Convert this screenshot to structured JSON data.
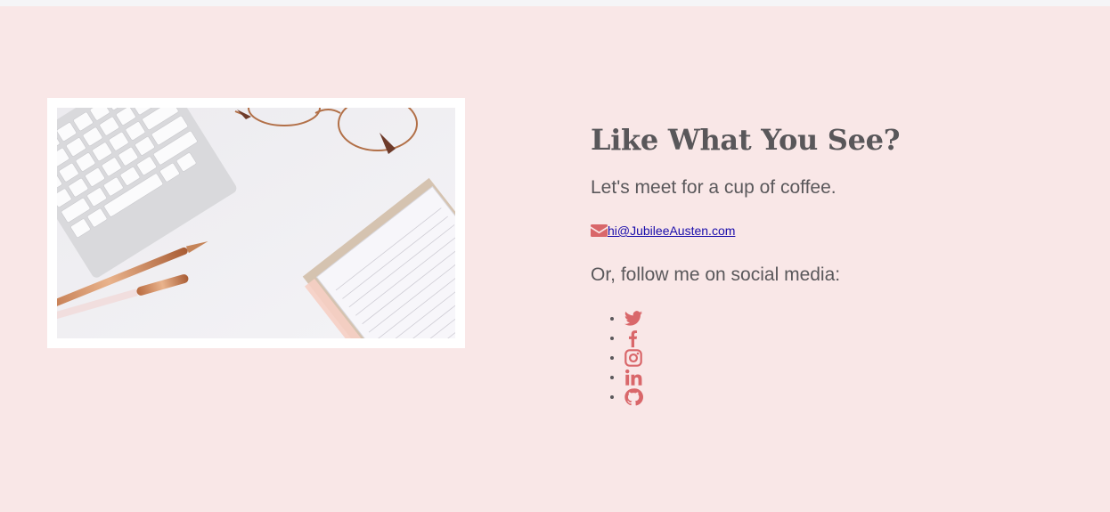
{
  "contact": {
    "heading": "Like What You See?",
    "tagline": "Let's meet for a cup of coffee.",
    "email": "hi@JubileeAusten.com",
    "follow_text": "Or, follow me on social media:",
    "social": [
      {
        "icon": "twitter-icon"
      },
      {
        "icon": "facebook-icon"
      },
      {
        "icon": "instagram-icon"
      },
      {
        "icon": "linkedin-icon"
      },
      {
        "icon": "github-icon"
      }
    ]
  },
  "colors": {
    "background": "#f9e7e7",
    "accent": "#d9676a",
    "text": "#5a585b",
    "link": "#1a0dab"
  }
}
